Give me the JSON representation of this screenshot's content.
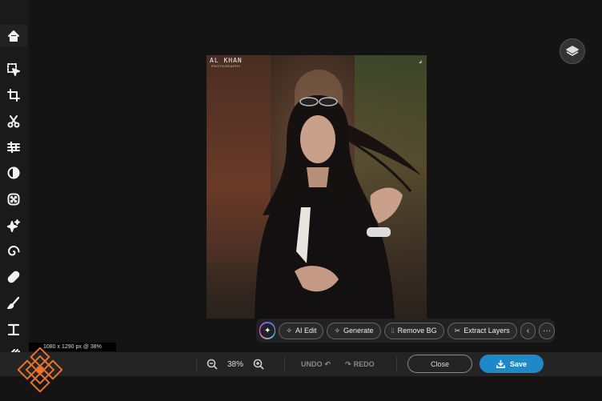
{
  "sidebar": {
    "tools": [
      {
        "name": "home-icon",
        "label": "Home"
      },
      {
        "name": "select-icon",
        "label": "Select"
      },
      {
        "name": "crop-icon",
        "label": "Crop"
      },
      {
        "name": "cutout-scissors-icon",
        "label": "Cutout"
      },
      {
        "name": "adjust-sliders-icon",
        "label": "Adjust"
      },
      {
        "name": "filter-contrast-icon",
        "label": "Filters"
      },
      {
        "name": "effects-grid-icon",
        "label": "Effects"
      },
      {
        "name": "ai-sparkle-icon",
        "label": "AI Tools"
      },
      {
        "name": "spiral-icon",
        "label": "Retouch"
      },
      {
        "name": "bandage-icon",
        "label": "Heal"
      },
      {
        "name": "brush-icon",
        "label": "Draw"
      },
      {
        "name": "text-icon",
        "label": "Text"
      },
      {
        "name": "texture-icon",
        "label": "Textures"
      }
    ]
  },
  "canvas": {
    "watermark_text": "AL KHAN",
    "watermark_sub": "PHOTOGRAPHY",
    "watermark_signature": "sig"
  },
  "ai_toolbar": {
    "spark_icon": "ai-sparkle-icon",
    "items": [
      {
        "label": "AI Edit",
        "icon": "sparkles-icon"
      },
      {
        "label": "Generate",
        "icon": "generate-icon"
      },
      {
        "label": "Remove BG",
        "icon": "remove-bg-icon"
      },
      {
        "label": "Extract Layers",
        "icon": "scissors-icon"
      }
    ],
    "prev_icon": "chevron-left-icon",
    "more_icon": "more-horizontal-icon"
  },
  "image_info": "1080 x 1290 px @ 38%",
  "bottom_bar": {
    "zoom": "38%",
    "undo": "UNDO",
    "redo": "REDO",
    "close": "Close",
    "save": "Save"
  },
  "colors": {
    "accent": "#1e88c8",
    "logo": "#e8722c",
    "background": "#141414"
  }
}
